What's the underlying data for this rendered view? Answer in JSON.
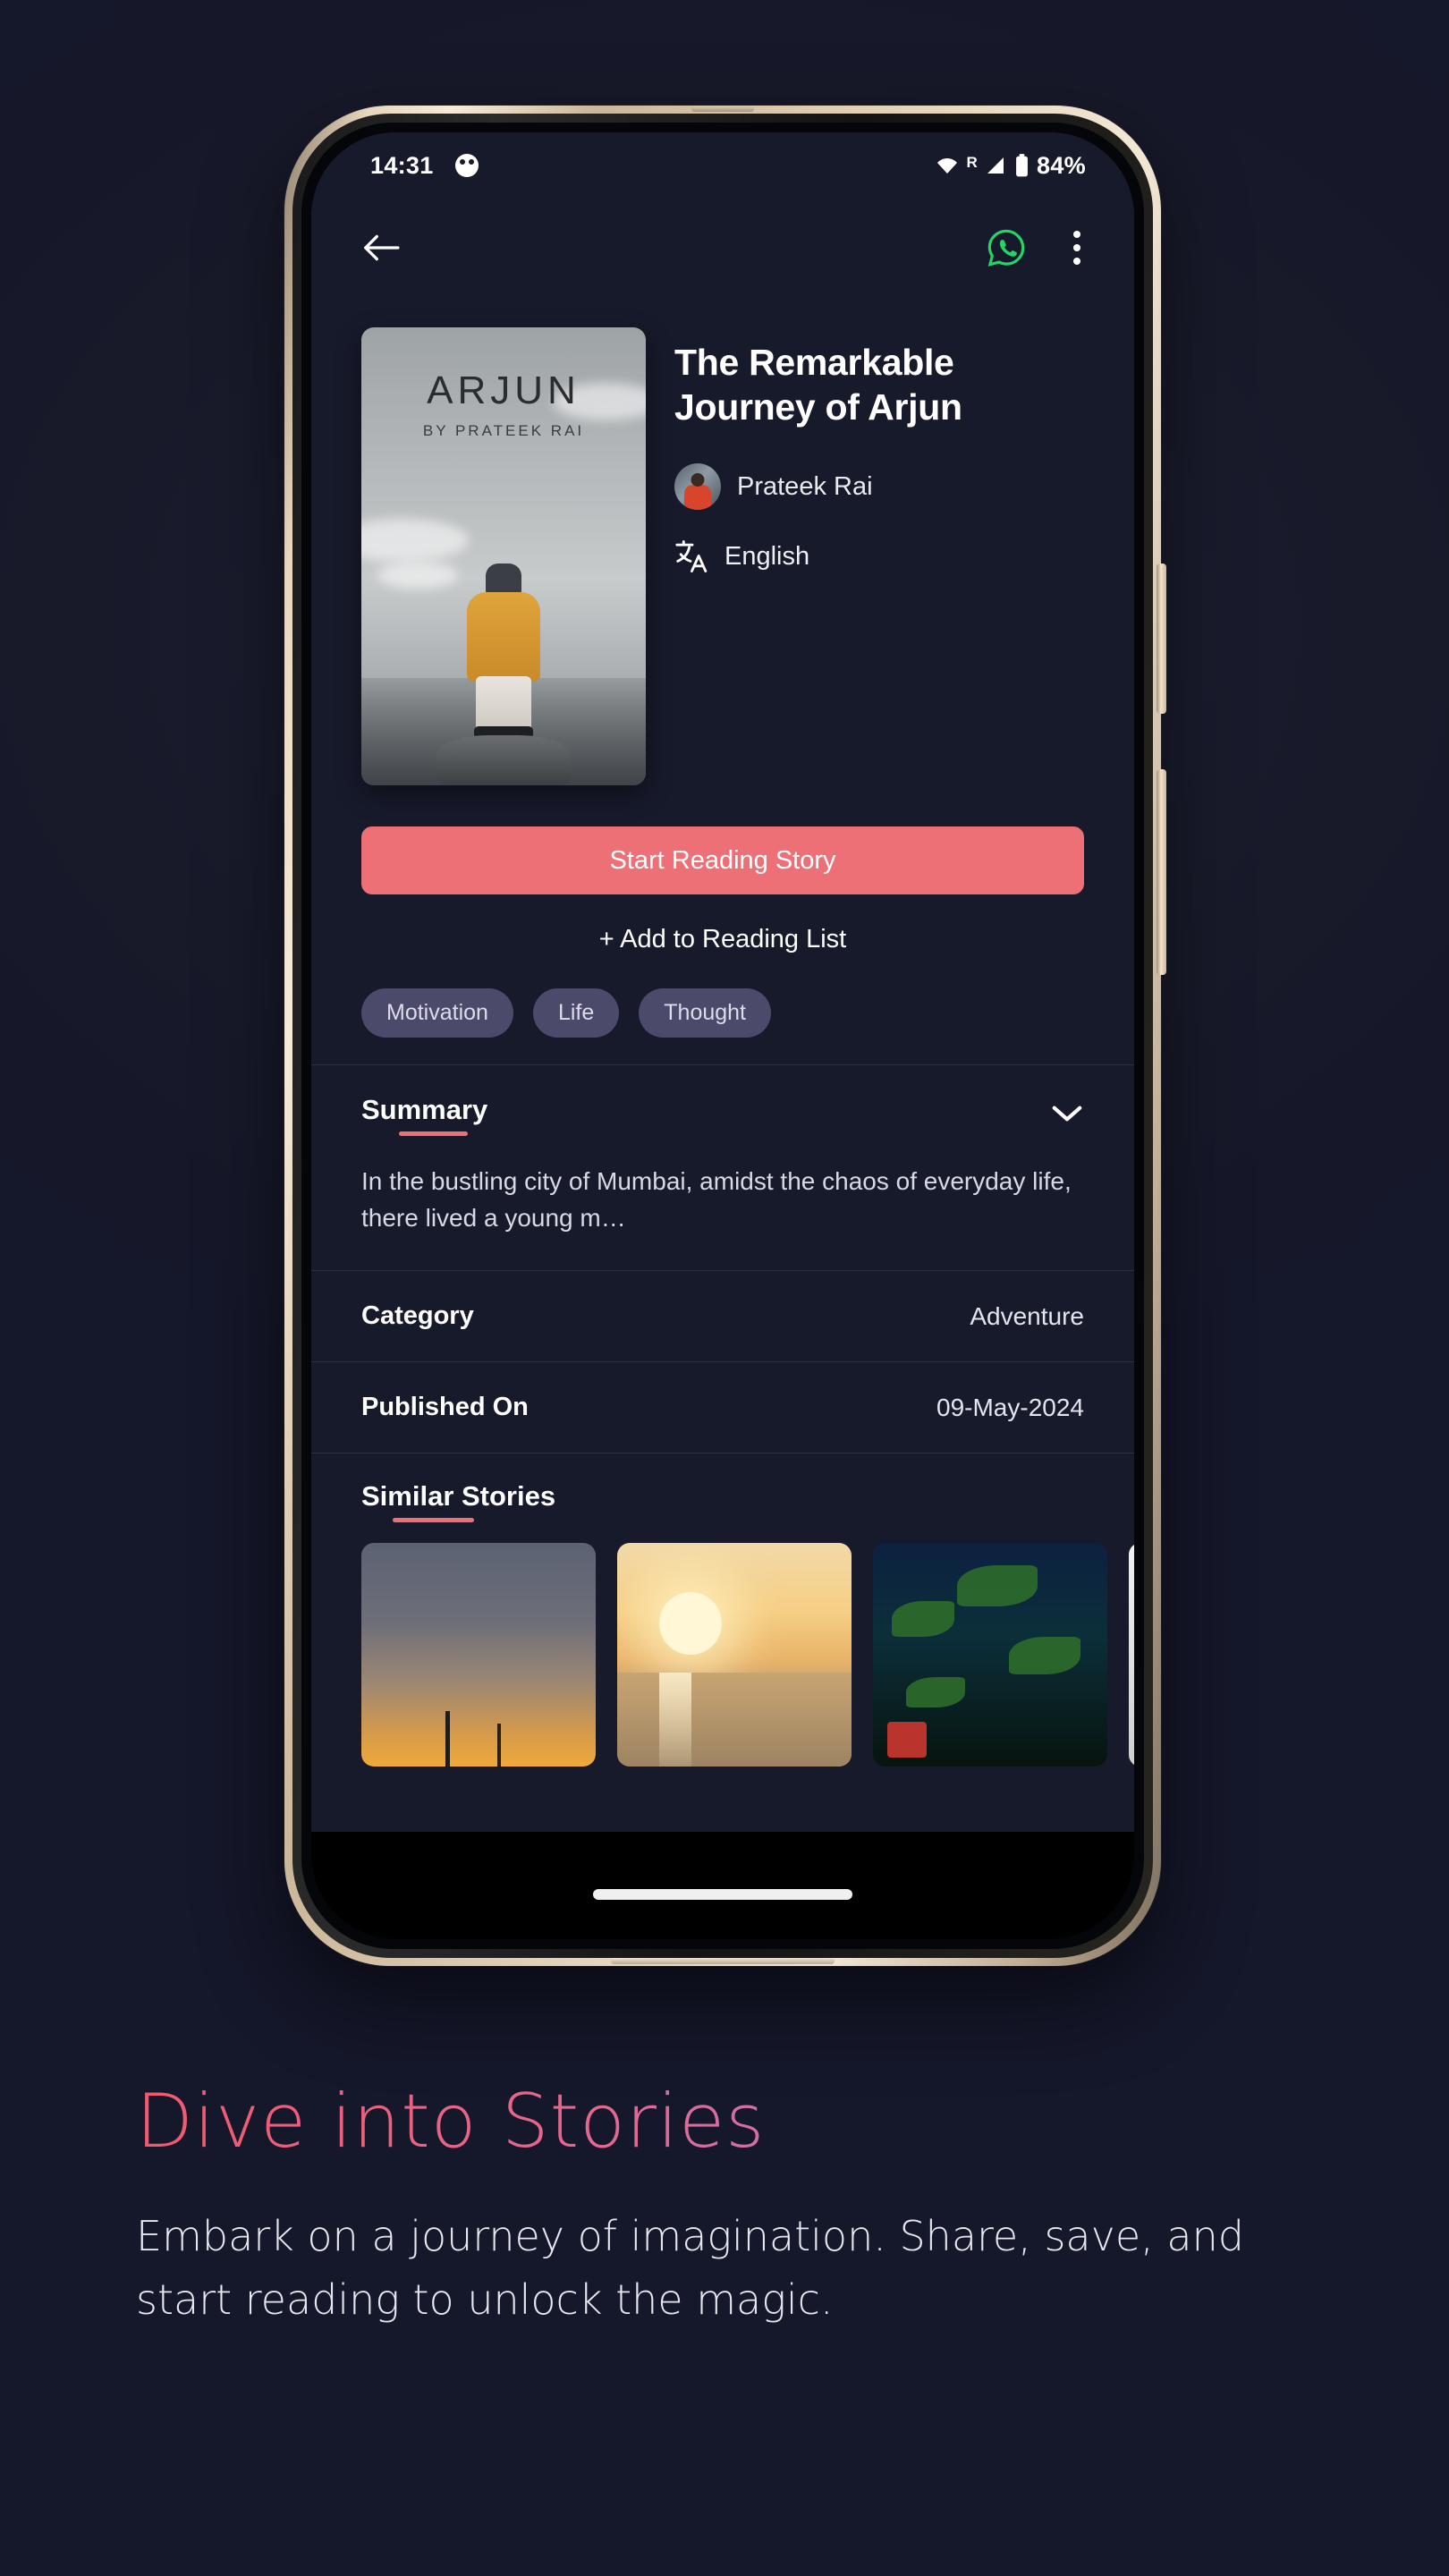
{
  "status_bar": {
    "time": "14:31",
    "icons": [
      "cat-face-icon",
      "wifi-icon",
      "signal-roaming-icon",
      "battery-icon"
    ],
    "roaming_label": "R",
    "battery_percent": "84%"
  },
  "toolbar": {
    "back_icon": "back-arrow-icon",
    "whatsapp_icon": "whatsapp-icon",
    "whatsapp_color": "#25D366",
    "overflow_icon": "more-vertical-icon"
  },
  "story": {
    "cover": {
      "title": "ARJUN",
      "byline": "BY PRATEEK RAI"
    },
    "title": "The Remarkable Journey of Arjun",
    "author": "Prateek Rai",
    "language": "English",
    "language_icon": "translate-icon"
  },
  "actions": {
    "primary_label": "Start Reading Story",
    "primary_color": "#ee7077",
    "secondary_label": "+ Add to Reading List"
  },
  "tags": [
    "Motivation",
    "Life",
    "Thought"
  ],
  "summary": {
    "heading": "Summary",
    "expand_icon": "chevron-down-icon",
    "text": "In the bustling city of Mumbai, amidst the chaos of everyday life, there lived a young m…"
  },
  "details": [
    {
      "key": "Category",
      "value": "Adventure"
    },
    {
      "key": "Published On",
      "value": "09-May-2024"
    }
  ],
  "similar": {
    "heading": "Similar Stories",
    "items": [
      "dusk-sky-thumbnail",
      "sunset-over-water-thumbnail",
      "night-foliage-thumbnail",
      "partial-thumbnail"
    ]
  },
  "caption": {
    "title": "Dive into Stories",
    "body": "Embark on a journey of imagination. Share, save, and start reading to unlock the magic.",
    "gradient_start": "#f05a6e",
    "gradient_end": "#9b79cd"
  }
}
